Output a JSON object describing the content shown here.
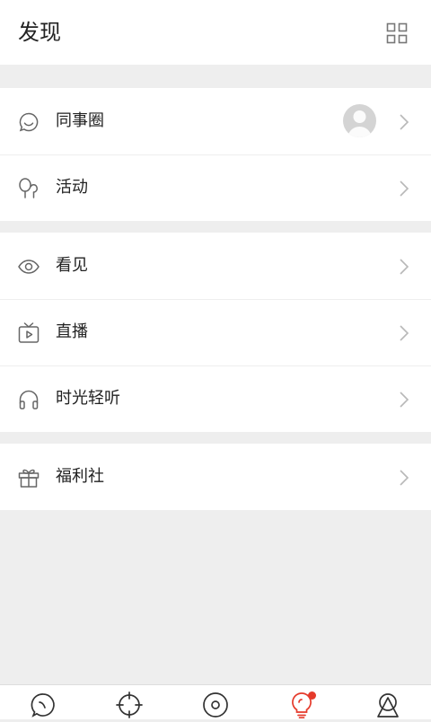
{
  "header": {
    "title": "发现",
    "menu_icon": "grid-icon"
  },
  "sections": [
    {
      "items": [
        {
          "label": "同事圈",
          "icon": "chat-bubble-icon",
          "has_avatar": true
        },
        {
          "label": "活动",
          "icon": "balloon-icon"
        }
      ]
    },
    {
      "items": [
        {
          "label": "看见",
          "icon": "eye-icon"
        },
        {
          "label": "直播",
          "icon": "tv-play-icon"
        },
        {
          "label": "时光轻听",
          "icon": "headphones-icon"
        }
      ]
    },
    {
      "items": [
        {
          "label": "福利社",
          "icon": "gift-icon"
        }
      ]
    }
  ],
  "tabbar": {
    "tabs": [
      {
        "icon": "message-tab-icon",
        "active": false
      },
      {
        "icon": "crosshair-tab-icon",
        "active": false
      },
      {
        "icon": "disc-tab-icon",
        "active": false
      },
      {
        "icon": "lightbulb-tab-icon",
        "active": true,
        "has_badge": true
      },
      {
        "icon": "profile-tab-icon",
        "active": false
      }
    ]
  },
  "colors": {
    "background": "#eeeeee",
    "surface": "#ffffff",
    "text": "#222222",
    "icon": "#666666",
    "chevron": "#b8b8b8",
    "accent": "#e53a2b"
  }
}
